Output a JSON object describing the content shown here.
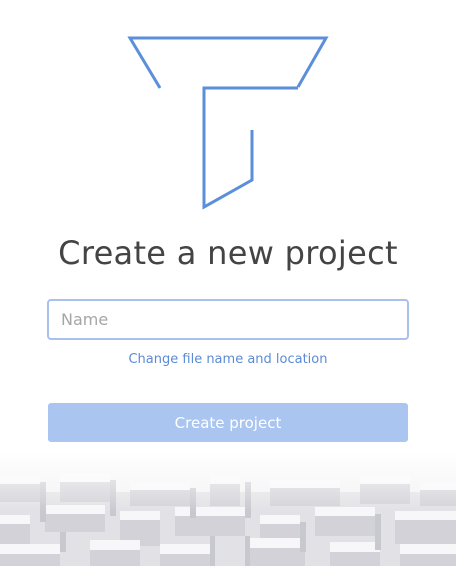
{
  "title": "Create a new project",
  "name_input": {
    "placeholder": "Name",
    "value": ""
  },
  "change_location_link": "Change file name and location",
  "create_button_label": "Create project",
  "colors": {
    "logo_stroke": "#5b8fd9",
    "field_border": "#a9c1ec",
    "link": "#5b8bd6",
    "button_disabled": "#a9c5f0",
    "title_text": "#444444"
  },
  "icons": {
    "logo": "app-logo-icon",
    "background": "maze-illustration"
  }
}
